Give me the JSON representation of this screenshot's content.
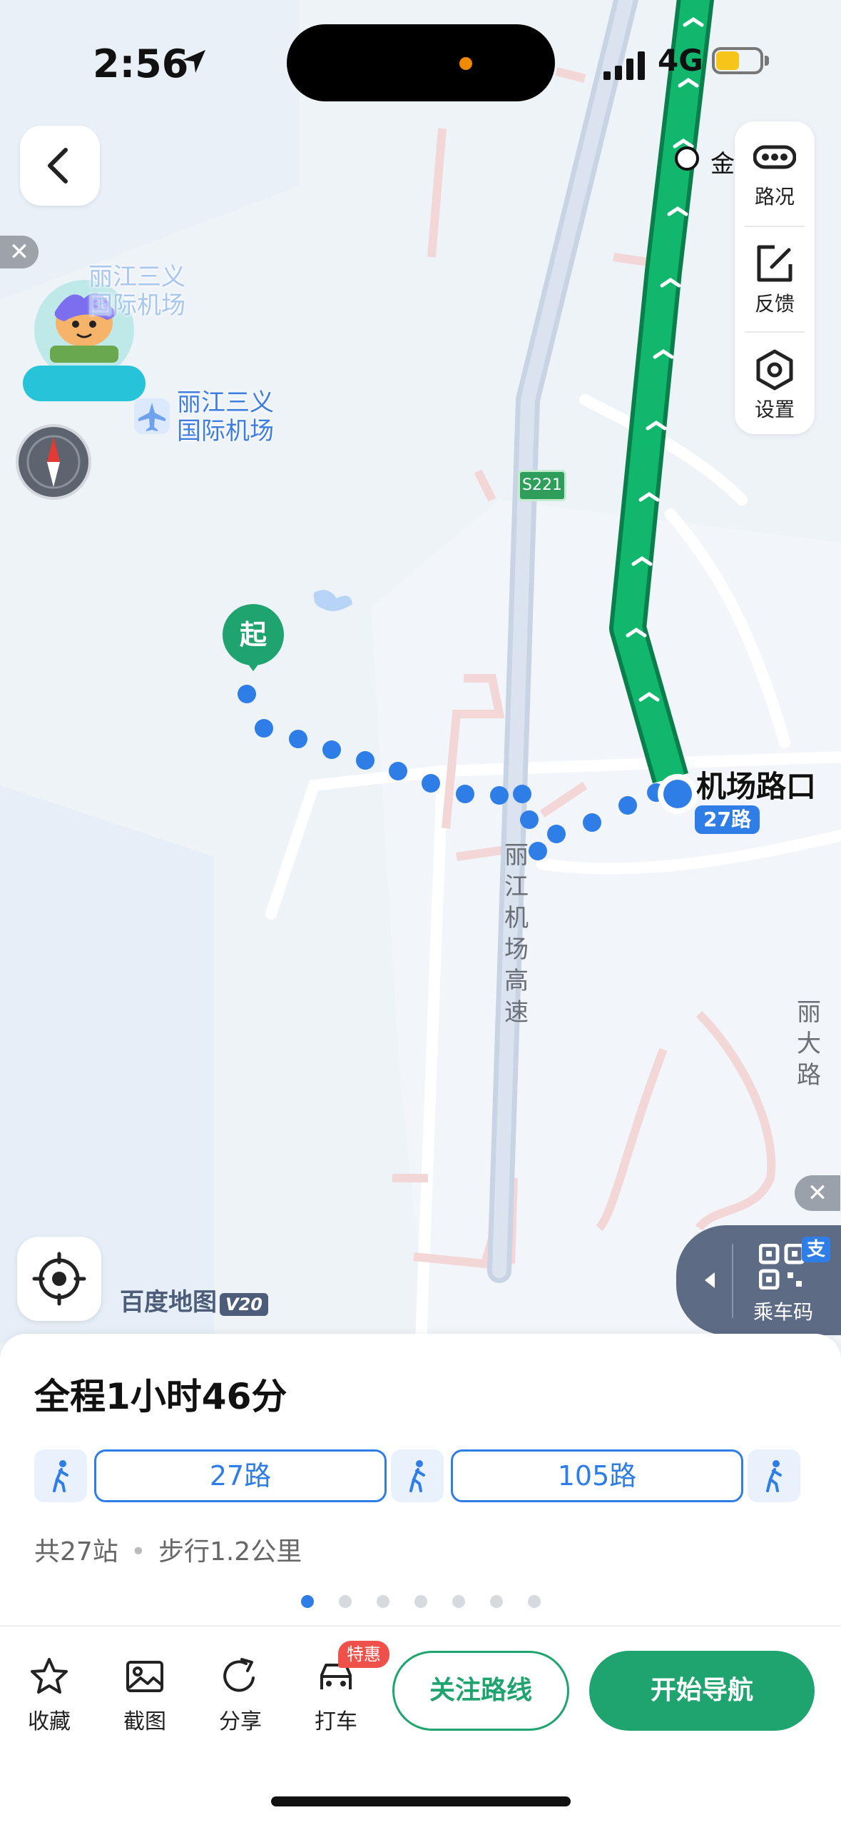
{
  "status": {
    "time": "2:56",
    "network": "4G"
  },
  "map": {
    "airport_label_faded": "丽江三义\n国际机场",
    "airport_label": "丽江三义\n国际机场",
    "road_expressway": "丽江机场高速",
    "road_lida": "丽大路",
    "road_shield": "S221",
    "gold_label": "金",
    "start_marker": "起",
    "stop_name": "机场路口",
    "stop_route": "27路",
    "watermark": "百度地图",
    "watermark_version": "V20"
  },
  "side_panel": [
    {
      "label": "路况",
      "icon": "traffic-icon"
    },
    {
      "label": "反馈",
      "icon": "feedback-icon"
    },
    {
      "label": "设置",
      "icon": "settings-icon"
    }
  ],
  "ride_code": {
    "label": "乘车码",
    "badge": "支"
  },
  "route": {
    "duration": "全程1小时46分",
    "segments": [
      {
        "type": "walk"
      },
      {
        "type": "bus",
        "label": "27路"
      },
      {
        "type": "walk"
      },
      {
        "type": "bus",
        "label": "105路"
      },
      {
        "type": "walk"
      }
    ],
    "stops_text": "共27站",
    "walk_text": "步行1.2公里",
    "page_count": 7,
    "current_page": 1
  },
  "actions": {
    "favorite": "收藏",
    "screenshot": "截图",
    "share": "分享",
    "taxi": "打车",
    "taxi_promo": "特惠",
    "follow": "关注路线",
    "start_nav": "开始导航"
  },
  "colors": {
    "accent": "#2f7de6",
    "green": "#1fa36f",
    "route_green": "#10b36b"
  }
}
